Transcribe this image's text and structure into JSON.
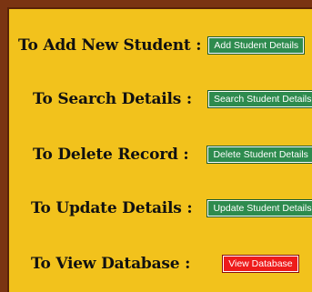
{
  "colors": {
    "panel_background": "#f2c21c",
    "border": "#7a3412",
    "green_button": "#2e8b4e",
    "red_button": "#ee1b1b"
  },
  "rows": [
    {
      "label": "To Add New Student :",
      "button": "Add Student Details"
    },
    {
      "label": "To Search Details :",
      "button": "Search Student Details"
    },
    {
      "label": "To Delete Record :",
      "button": "Delete Student Details"
    },
    {
      "label": "To Update Details :",
      "button": "Update Student Details"
    },
    {
      "label": "To View Database :",
      "button": "View Database"
    }
  ]
}
